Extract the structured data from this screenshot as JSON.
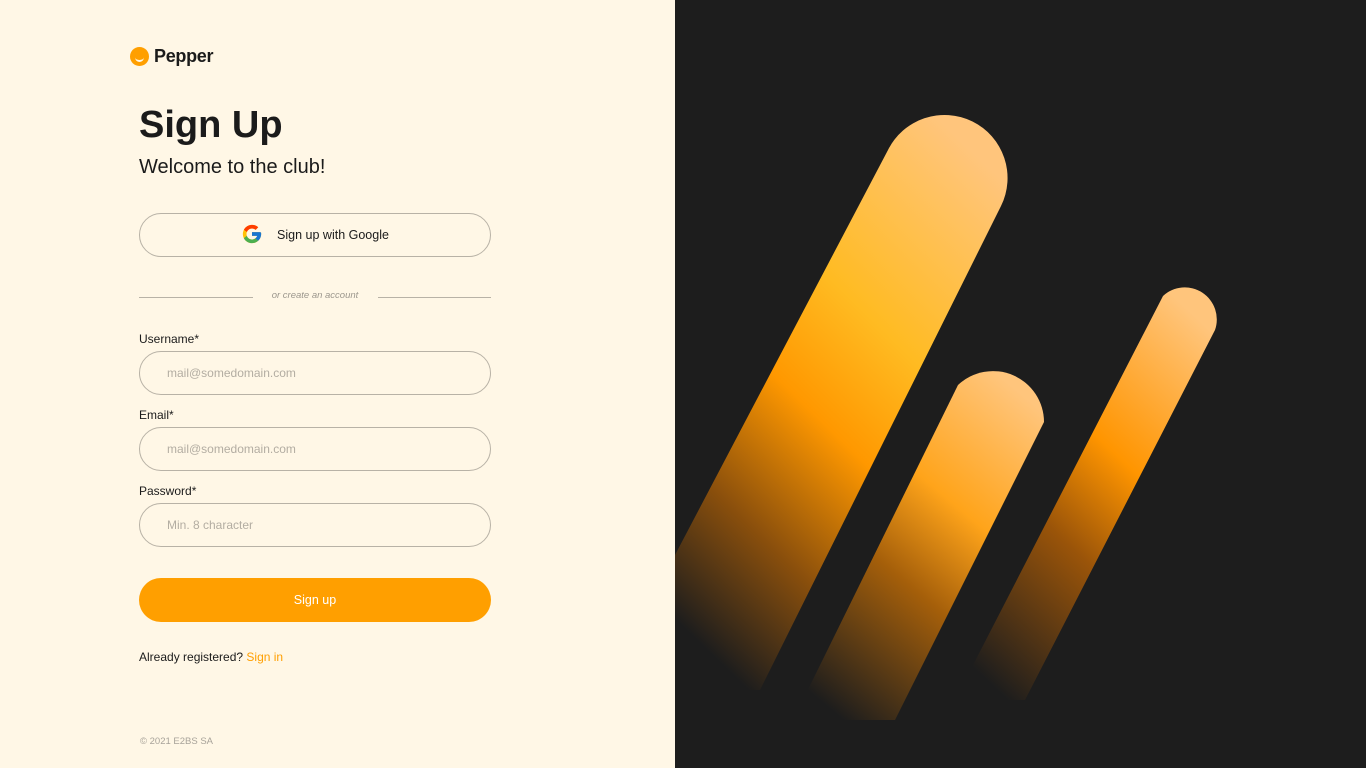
{
  "brand": {
    "name": "Pepper"
  },
  "heading": {
    "title": "Sign Up",
    "subtitle": "Welcome to the club!"
  },
  "google": {
    "label": "Sign up  with Google"
  },
  "divider": {
    "text": "or create an account"
  },
  "form": {
    "username": {
      "label": "Username*",
      "placeholder": "mail@somedomain.com",
      "value": ""
    },
    "email": {
      "label": "Email*",
      "placeholder": "mail@somedomain.com",
      "value": ""
    },
    "password": {
      "label": "Password*",
      "placeholder": "Min. 8 character",
      "value": ""
    },
    "submit_label": "Sign up"
  },
  "signin": {
    "prompt": "Already registered?",
    "link": "Sign in"
  },
  "footer": {
    "copyright": "© 2021 E2BS SA"
  },
  "colors": {
    "accent": "#ff9f00",
    "background": "#fff7e6",
    "panel": "#1d1d1d"
  }
}
